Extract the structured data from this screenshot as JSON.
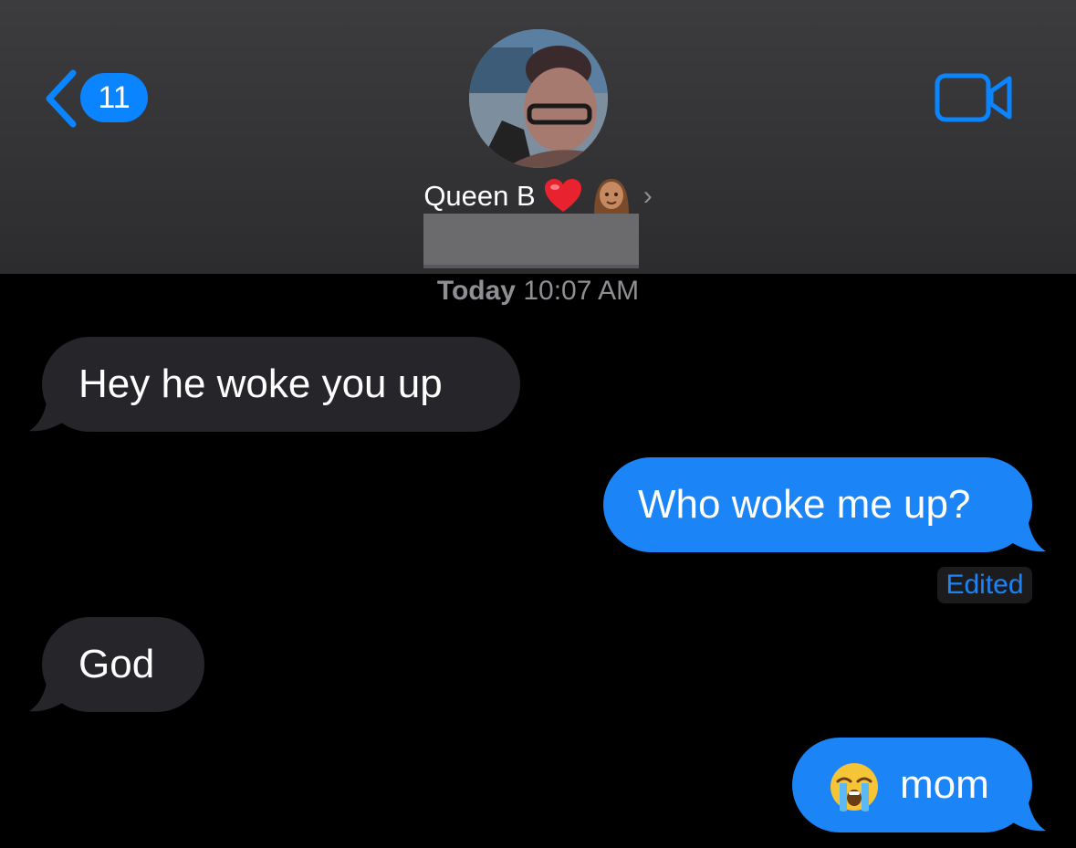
{
  "header": {
    "back_badge_count": "11",
    "contact_name": "Queen B",
    "colors": {
      "accent": "#0a84ff",
      "header_bg": "#333335"
    },
    "icons": [
      "chevron-left-icon",
      "video-camera-icon",
      "heart-emoji-icon",
      "person-emoji-icon",
      "chevron-right-icon"
    ]
  },
  "conversation": {
    "timestamp_day": "Today",
    "timestamp_time": "10:07 AM",
    "messages": [
      {
        "direction": "incoming",
        "text": "Hey he woke you up"
      },
      {
        "direction": "outgoing",
        "text": "Who woke me up?",
        "status": "Edited"
      },
      {
        "direction": "incoming",
        "text": "God"
      },
      {
        "direction": "outgoing",
        "text": "mom",
        "emoji": "crying-face-emoji"
      }
    ],
    "colors": {
      "incoming_bubble": "#26252a",
      "outgoing_bubble": "#1b84f7",
      "background": "#000000"
    }
  }
}
